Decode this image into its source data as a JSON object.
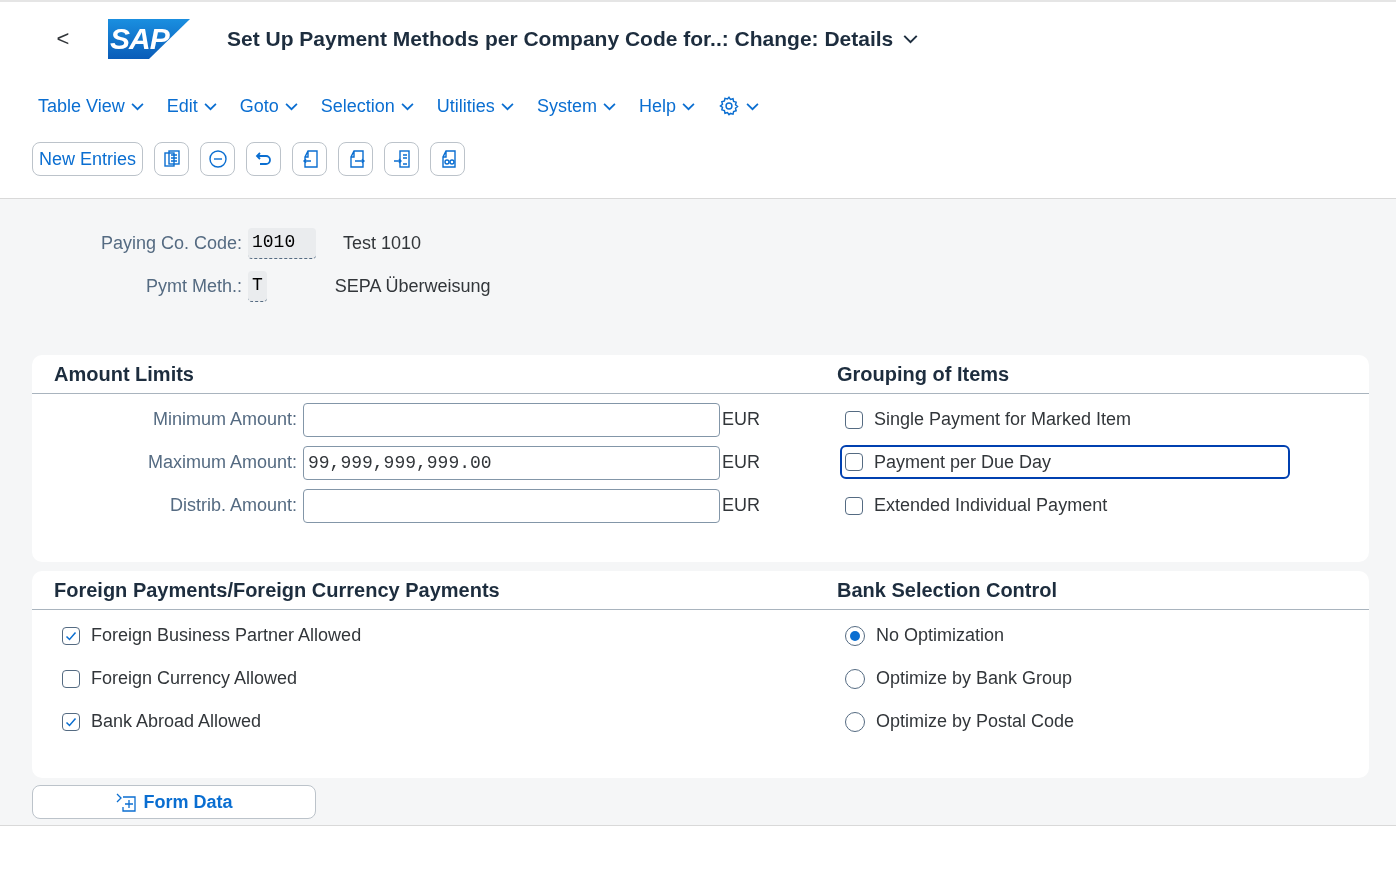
{
  "header": {
    "back": "<",
    "logo": "SAP",
    "title": "Set Up Payment Methods per Company Code for..: Change: Details"
  },
  "menu": [
    {
      "label": "Table View"
    },
    {
      "label": "Edit"
    },
    {
      "label": "Goto"
    },
    {
      "label": "Selection"
    },
    {
      "label": "Utilities"
    },
    {
      "label": "System"
    },
    {
      "label": "Help"
    }
  ],
  "toolbar": {
    "new_entries": "New Entries"
  },
  "key_fields": [
    {
      "label": "Paying Co. Code:",
      "value": "1010",
      "description": "Test 1010"
    },
    {
      "label": "Pymt Meth.:",
      "value": "T",
      "description": "SEPA Überweisung"
    }
  ],
  "sections": [
    {
      "left": {
        "title": "Amount Limits",
        "kind": "amounts",
        "items": [
          {
            "label": "Minimum Amount:",
            "unit": "EUR"
          },
          {
            "label": "Maximum Amount:",
            "value": "99,999,999,999.00",
            "unit": "EUR"
          },
          {
            "label": "Distrib. Amount:",
            "unit": "EUR"
          }
        ]
      },
      "right": {
        "title": "Grouping of Items",
        "kind": "checkboxes",
        "items": [
          {
            "label": "Single Payment for Marked Item",
            "checked": false,
            "focused": false
          },
          {
            "label": "Payment per Due Day",
            "checked": false,
            "focused": true
          },
          {
            "label": "Extended Individual Payment",
            "checked": false,
            "focused": false
          }
        ]
      }
    },
    {
      "left": {
        "title": "Foreign Payments/Foreign Currency Payments",
        "kind": "checkboxes",
        "items": [
          {
            "label": "Foreign Business Partner Allowed",
            "checked": true,
            "focused": false
          },
          {
            "label": "Foreign Currency Allowed",
            "checked": false,
            "focused": false
          },
          {
            "label": "Bank Abroad Allowed",
            "checked": true,
            "focused": false
          }
        ]
      },
      "right": {
        "title": "Bank Selection Control",
        "kind": "radios",
        "items": [
          {
            "label": "No Optimization",
            "selected": true
          },
          {
            "label": "Optimize by Bank Group",
            "selected": false
          },
          {
            "label": "Optimize by Postal Code",
            "selected": false
          }
        ]
      }
    }
  ],
  "form_data_button": "Form Data"
}
